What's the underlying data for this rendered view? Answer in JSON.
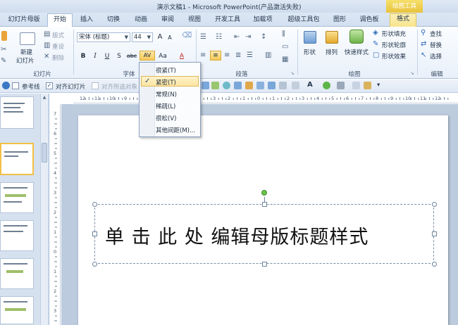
{
  "window": {
    "title": "演示文稿1 - Microsoft PowerPoint(产品激活失败)",
    "context_label": "绘图工具"
  },
  "tabs": [
    {
      "label": "幻灯片母版"
    },
    {
      "label": "开始",
      "active": true
    },
    {
      "label": "插入"
    },
    {
      "label": "切换"
    },
    {
      "label": "动画"
    },
    {
      "label": "审阅"
    },
    {
      "label": "视图"
    },
    {
      "label": "开发工具"
    },
    {
      "label": "加载项"
    },
    {
      "label": "超级工具包"
    },
    {
      "label": "图形"
    },
    {
      "label": "调色板"
    },
    {
      "label": "格式"
    }
  ],
  "ribbon": {
    "slides_group": {
      "label": "幻灯片",
      "new_slide_line1": "新建",
      "new_slide_line2": "幻灯片",
      "layout": "版式",
      "reset": "重设",
      "delete": "删除"
    },
    "font_group": {
      "label": "字体",
      "font_name": "宋体 (标题)",
      "font_size": "44",
      "bold": "B",
      "italic": "I",
      "underline": "U",
      "shadow": "S",
      "strike": "abc",
      "spacing": "AV",
      "case": "Aa",
      "color": "A",
      "grow": "A",
      "shrink": "A"
    },
    "paragraph_group": {
      "label": "段落"
    },
    "drawing_group": {
      "label": "绘图",
      "shapes": "形状",
      "arrange": "排列",
      "quick_styles": "快速样式",
      "fill": "形状填充",
      "outline": "形状轮廓",
      "effects": "形状效果"
    },
    "editing_group": {
      "label": "编辑",
      "find": "查找",
      "replace": "替换",
      "select": "选择"
    }
  },
  "qat": {
    "guides": "参考线",
    "align": "对齐幻灯片",
    "align_selected": "对齐所选对象"
  },
  "spacing_menu": {
    "items": [
      {
        "label": "很紧(T)",
        "checked": false
      },
      {
        "label": "紧密(T)",
        "checked": true
      },
      {
        "label": "常规(N)",
        "checked": false
      },
      {
        "label": "稀疏(L)",
        "checked": false
      },
      {
        "label": "很松(V)",
        "checked": false
      },
      {
        "label": "其他间距(M)...",
        "checked": false
      }
    ]
  },
  "ruler": {
    "h_numbers": [
      "12",
      "11",
      "10",
      "9",
      "8",
      "7",
      "6",
      "5",
      "4",
      "3",
      "2",
      "1",
      "0",
      "1",
      "2",
      "3",
      "4",
      "5",
      "6",
      "7",
      "8",
      "9",
      "10",
      "11",
      "12"
    ],
    "v_numbers": [
      "7",
      "6",
      "5",
      "4",
      "3",
      "2",
      "1",
      "0",
      "1",
      "2",
      "3"
    ]
  },
  "slide": {
    "title_placeholder": "单 击 此 处 编辑母版标题样式"
  }
}
